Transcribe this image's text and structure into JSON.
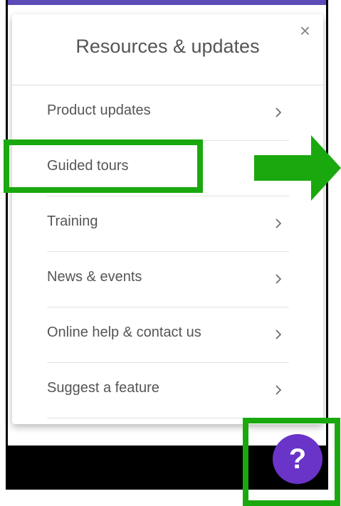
{
  "panel": {
    "title": "Resources & updates",
    "close_glyph": "×",
    "items": [
      {
        "label": "Product updates",
        "has_chevron": true
      },
      {
        "label": "Guided tours",
        "has_chevron": false
      },
      {
        "label": "Training",
        "has_chevron": true
      },
      {
        "label": "News & events",
        "has_chevron": true
      },
      {
        "label": "Online help & contact us",
        "has_chevron": true
      },
      {
        "label": "Suggest a feature",
        "has_chevron": true
      }
    ]
  },
  "help_button": {
    "glyph": "?"
  },
  "colors": {
    "top_bar": "#5c4cb8",
    "help_button": "#6a34c8",
    "highlight": "#1aa80f"
  },
  "icons": {
    "close": "close-icon",
    "chevron": "chevron-right-icon",
    "help": "question-mark-icon",
    "annotation": "green-arrow-icon"
  }
}
